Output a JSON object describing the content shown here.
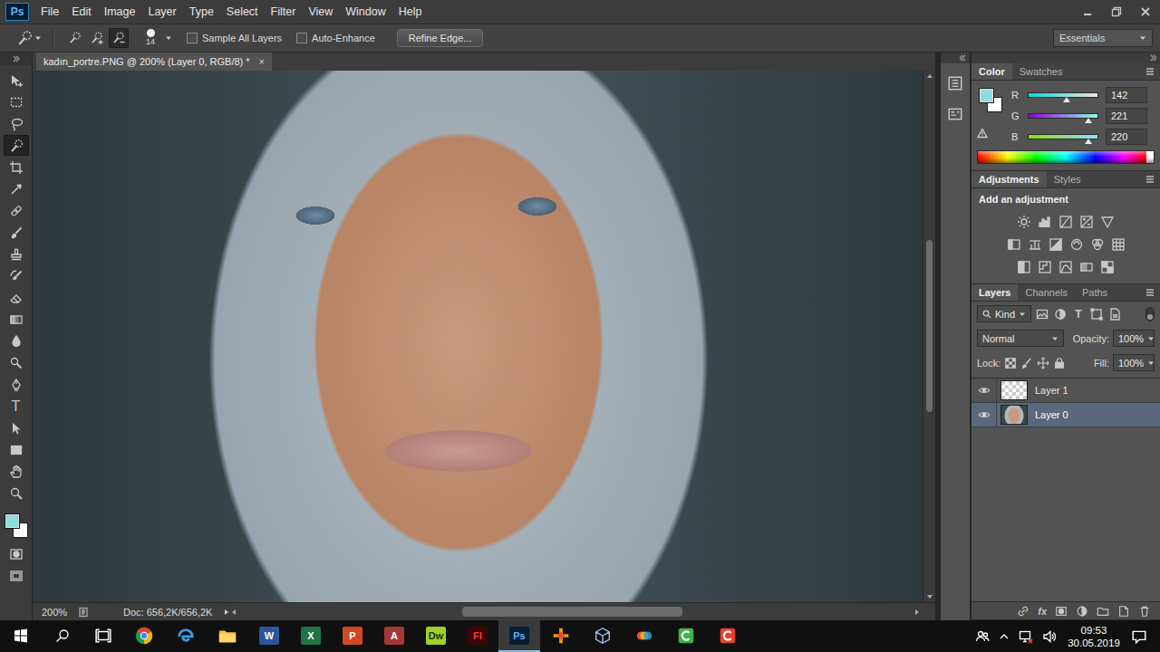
{
  "app_logo": "Ps",
  "menu": [
    "File",
    "Edit",
    "Image",
    "Layer",
    "Type",
    "Select",
    "Filter",
    "View",
    "Window",
    "Help"
  ],
  "options_bar": {
    "modes": [
      {
        "kind": "new",
        "selected": false
      },
      {
        "kind": "add",
        "selected": false
      },
      {
        "kind": "subtract",
        "selected": true
      }
    ],
    "brush_size": "14",
    "checkboxes": [
      {
        "label": "Sample All Layers",
        "checked": false
      },
      {
        "label": "Auto-Enhance",
        "checked": false
      }
    ],
    "button": "Refine Edge...",
    "workspace": "Essentials"
  },
  "tools": [
    {
      "kind": "move",
      "selected": false
    },
    {
      "kind": "marquee",
      "selected": false
    },
    {
      "kind": "lasso",
      "selected": false
    },
    {
      "kind": "quick-select",
      "selected": true
    },
    {
      "kind": "crop",
      "selected": false
    },
    {
      "kind": "eyedropper",
      "selected": false
    },
    {
      "kind": "heal",
      "selected": false
    },
    {
      "kind": "brush",
      "selected": false
    },
    {
      "kind": "stamp",
      "selected": false
    },
    {
      "kind": "history-brush",
      "selected": false
    },
    {
      "kind": "eraser",
      "selected": false
    },
    {
      "kind": "gradient",
      "selected": false
    },
    {
      "kind": "blur",
      "selected": false
    },
    {
      "kind": "dodge",
      "selected": false
    },
    {
      "kind": "pen",
      "selected": false
    },
    {
      "kind": "type",
      "label": "T",
      "selected": false
    },
    {
      "kind": "path-select",
      "selected": false
    },
    {
      "kind": "shape",
      "selected": false
    },
    {
      "kind": "hand",
      "selected": false
    },
    {
      "kind": "zoom",
      "selected": false
    }
  ],
  "colors": {
    "foreground": "#8edddc",
    "background": "#ffffff"
  },
  "document": {
    "tab": "kadın_portre.PNG @ 200% (Layer 0, RGB/8) *",
    "close": "×",
    "zoom": "200%",
    "doc_size": "Doc: 656,2K/656,2K",
    "scroll": {
      "vertical": {
        "offset": 0.31,
        "size": 0.34
      },
      "horizontal": {
        "offset": 0.33,
        "size": 0.33
      }
    }
  },
  "color_panel": {
    "tabs": [
      {
        "label": "Color",
        "selected": true
      },
      {
        "label": "Swatches",
        "selected": false
      }
    ],
    "channels": [
      {
        "name": "R",
        "value": "142",
        "level": 0.557
      },
      {
        "name": "G",
        "value": "221",
        "level": 0.867
      },
      {
        "name": "B",
        "value": "220",
        "level": 0.863
      }
    ]
  },
  "adjustments_panel": {
    "tabs": [
      {
        "label": "Adjustments",
        "selected": true
      },
      {
        "label": "Styles",
        "selected": false
      }
    ],
    "heading": "Add an adjustment"
  },
  "layers_panel": {
    "tabs": [
      {
        "label": "Layers",
        "selected": true
      },
      {
        "label": "Channels",
        "selected": false
      },
      {
        "label": "Paths",
        "selected": false
      }
    ],
    "filter": "Kind",
    "filter_type_label": "T",
    "blend_mode": "Normal",
    "opacity_label": "Opacity:",
    "opacity": "100%",
    "lock_label": "Lock:",
    "fill_label": "Fill:",
    "fill": "100%",
    "layers": [
      {
        "name": "Layer 1",
        "visible": true,
        "selected": false,
        "kind": "transparent"
      },
      {
        "name": "Layer 0",
        "visible": true,
        "selected": true,
        "kind": "photo"
      }
    ],
    "footer_fx": "fx"
  },
  "taskbar": {
    "apps": [
      {
        "kind": "chrome",
        "active": false
      },
      {
        "kind": "edge",
        "active": false
      },
      {
        "kind": "explorer",
        "active": false
      },
      {
        "kind": "tile",
        "label": "W",
        "color": "#2b579a",
        "ink": "#ffffff",
        "active": false
      },
      {
        "kind": "tile",
        "label": "X",
        "color": "#217346",
        "ink": "#ffffff",
        "active": false
      },
      {
        "kind": "tile",
        "label": "P",
        "color": "#d24726",
        "ink": "#ffffff",
        "active": false
      },
      {
        "kind": "tile",
        "label": "A",
        "color": "#a4373a",
        "ink": "#ffffff",
        "active": false
      },
      {
        "kind": "tile",
        "label": "Dw",
        "color": "#9fcf2b",
        "ink": "#1c3300",
        "active": false
      },
      {
        "kind": "tile",
        "label": "Fl",
        "color": "#3a0505",
        "ink": "#ff4030",
        "active": false
      },
      {
        "kind": "tile",
        "label": "Ps",
        "color": "#061e33",
        "ink": "#5cb8ff",
        "active": true
      },
      {
        "kind": "orange-app",
        "active": false
      },
      {
        "kind": "cube-app",
        "active": false
      },
      {
        "kind": "circles-app",
        "active": false
      },
      {
        "kind": "green-app",
        "active": false
      },
      {
        "kind": "red-app",
        "active": false
      }
    ],
    "time": "09:53",
    "date": "30.05.2019"
  }
}
